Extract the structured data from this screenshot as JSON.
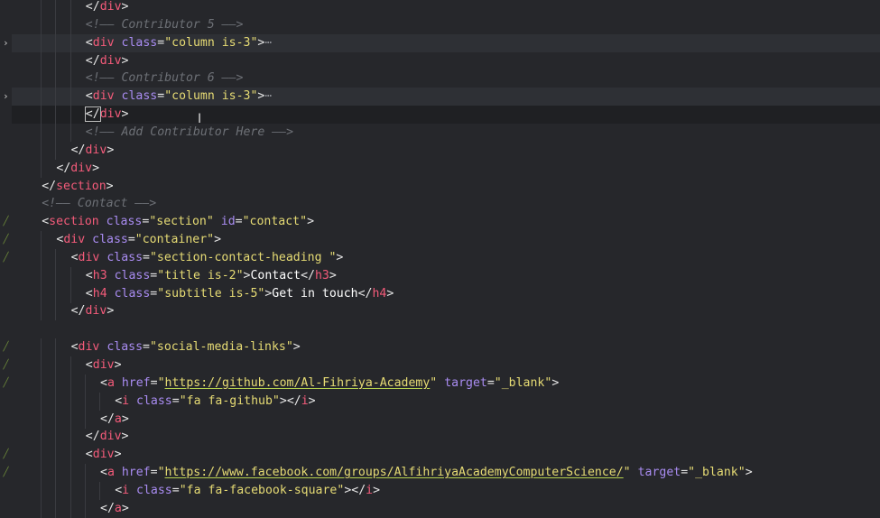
{
  "editor": {
    "language": "html",
    "lines": [
      "</div>",
      "<!-- Contributor 5 -->",
      "<div class=\"column is-3\">…",
      "</div>",
      "<!-- Contributor 6 -->",
      "<div class=\"column is-3\">…",
      "</div>",
      "<!-- Add Contributor Here -->",
      "</div>",
      "</div>",
      "</section>",
      "<!-- Contact -->",
      "<section class=\"section\" id=\"contact\">",
      "<div class=\"container\">",
      "<div class=\"section-contact-heading \">",
      "<h3 class=\"title is-2\">Contact</h3>",
      "<h4 class=\"subtitle is-5\">Get in touch</h4>",
      "</div>",
      "",
      "<div class=\"social-media-links\">",
      "<div>",
      "<a href=\"https://github.com/Al-Fihriya-Academy\" target=\"_blank\">",
      "<i class=\"fa fa-github\"></i>",
      "</a>",
      "</div>",
      "<div>",
      "<a href=\"https://www.facebook.com/groups/AlfihriyaAcademyComputerScience/\" target=\"_blank\">",
      "<i class=\"fa fa-facebook-square\"></i>",
      "</a>"
    ]
  },
  "colors": {
    "background": "#26272b",
    "tag": "#f45b7a",
    "attribute": "#a98cf2",
    "string": "#e6db74",
    "comment": "#6d7076",
    "text": "#ffffff",
    "git_modified": "#6d8a3a"
  },
  "icons": {
    "fold_chevron": "chevron-right-icon",
    "modified_marker": "git-modified-icon",
    "mouse_cursor": "text-cursor-icon"
  }
}
